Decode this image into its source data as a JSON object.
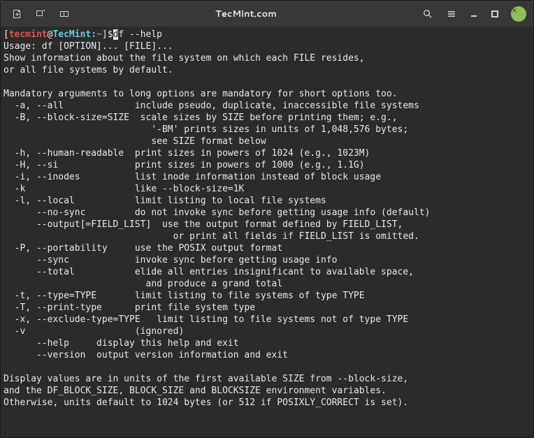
{
  "titlebar": {
    "title": "TecMint.com"
  },
  "prompt": {
    "open_bracket": "[",
    "user": "tecmint",
    "at": "@",
    "host": "TecMint:",
    "path": "~",
    "close_bracket": "]",
    "dollar": "$"
  },
  "command": {
    "first_char": "d",
    "rest": "f --help"
  },
  "output": {
    "l01": "Usage: df [OPTION]... [FILE]...",
    "l02": "Show information about the file system on which each FILE resides,",
    "l03": "or all file systems by default.",
    "l04": "",
    "l05": "Mandatory arguments to long options are mandatory for short options too.",
    "l06": "  -a, --all             include pseudo, duplicate, inaccessible file systems",
    "l07": "  -B, --block-size=SIZE  scale sizes by SIZE before printing them; e.g.,",
    "l08": "                           '-BM' prints sizes in units of 1,048,576 bytes;",
    "l09": "                           see SIZE format below",
    "l10": "  -h, --human-readable  print sizes in powers of 1024 (e.g., 1023M)",
    "l11": "  -H, --si              print sizes in powers of 1000 (e.g., 1.1G)",
    "l12": "  -i, --inodes          list inode information instead of block usage",
    "l13": "  -k                    like --block-size=1K",
    "l14": "  -l, --local           limit listing to local file systems",
    "l15": "      --no-sync         do not invoke sync before getting usage info (default)",
    "l16": "      --output[=FIELD_LIST]  use the output format defined by FIELD_LIST,",
    "l17": "                               or print all fields if FIELD_LIST is omitted.",
    "l18": "  -P, --portability     use the POSIX output format",
    "l19": "      --sync            invoke sync before getting usage info",
    "l20": "      --total           elide all entries insignificant to available space,",
    "l21": "                          and produce a grand total",
    "l22": "  -t, --type=TYPE       limit listing to file systems of type TYPE",
    "l23": "  -T, --print-type      print file system type",
    "l24": "  -x, --exclude-type=TYPE   limit listing to file systems not of type TYPE",
    "l25": "  -v                    (ignored)",
    "l26": "      --help     display this help and exit",
    "l27": "      --version  output version information and exit",
    "l28": "",
    "l29": "Display values are in units of the first available SIZE from --block-size,",
    "l30": "and the DF_BLOCK_SIZE, BLOCK_SIZE and BLOCKSIZE environment variables.",
    "l31": "Otherwise, units default to 1024 bytes (or 512 if POSIXLY_CORRECT is set)."
  }
}
